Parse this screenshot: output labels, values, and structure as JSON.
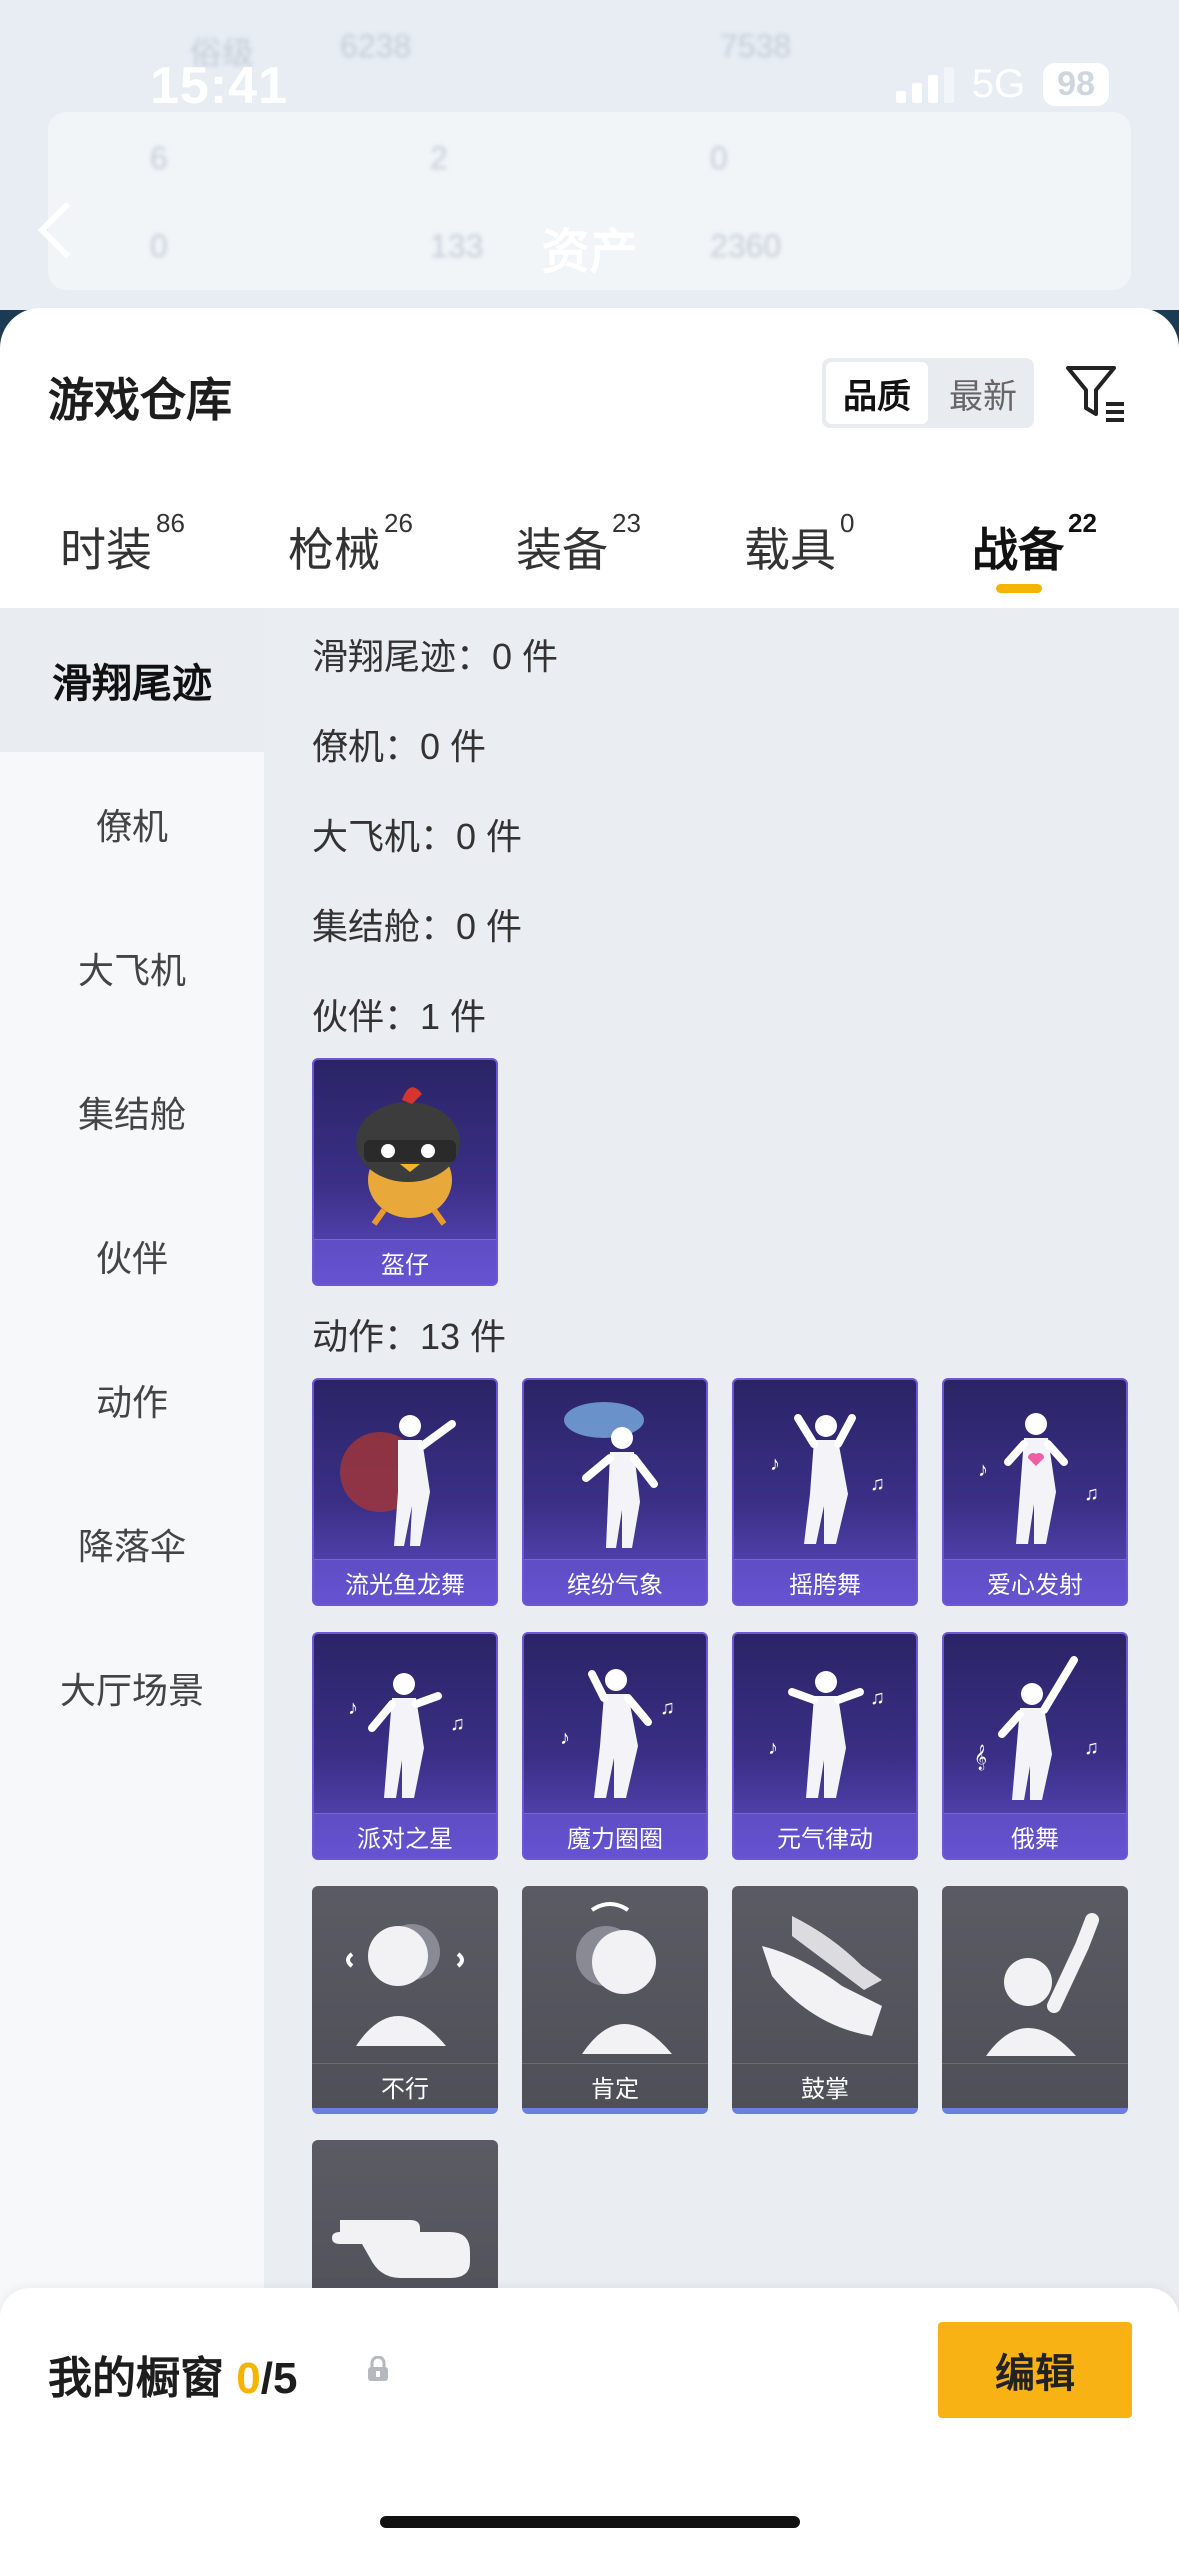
{
  "status_bar": {
    "time": "15:41",
    "network": "5G",
    "battery": "98"
  },
  "background": {
    "title": "资产",
    "ghost_texts": [
      "俗级",
      "6238",
      "7538",
      "6",
      "2",
      "0",
      "0",
      "133",
      "2360"
    ]
  },
  "sheet": {
    "title": "游戏仓库",
    "sort": {
      "quality": "品质",
      "latest": "最新"
    },
    "tabs": [
      {
        "label": "时装",
        "count": "86"
      },
      {
        "label": "枪械",
        "count": "26"
      },
      {
        "label": "装备",
        "count": "23"
      },
      {
        "label": "载具",
        "count": "0"
      },
      {
        "label": "战备",
        "count": "22"
      }
    ],
    "sidebar": [
      {
        "label": "滑翔尾迹"
      },
      {
        "label": "僚机"
      },
      {
        "label": "大飞机"
      },
      {
        "label": "集结舱"
      },
      {
        "label": "伙伴"
      },
      {
        "label": "动作"
      },
      {
        "label": "降落伞"
      },
      {
        "label": "大厅场景"
      }
    ],
    "categories": [
      {
        "label": "滑翔尾迹：0 件"
      },
      {
        "label": "僚机：0 件"
      },
      {
        "label": "大飞机：0 件"
      },
      {
        "label": "集结舱：0 件"
      },
      {
        "label": "伙伴：1 件"
      },
      {
        "label": "动作：13 件"
      }
    ],
    "partner_items": [
      {
        "name": "盔仔"
      }
    ],
    "action_items": [
      {
        "name": "流光鱼龙舞"
      },
      {
        "name": "缤纷气象"
      },
      {
        "name": "摇胯舞"
      },
      {
        "name": "爱心发射"
      },
      {
        "name": "派对之星"
      },
      {
        "name": "魔力圈圈"
      },
      {
        "name": "元气律动"
      },
      {
        "name": "俄舞"
      },
      {
        "name": "不行"
      },
      {
        "name": "肯定"
      },
      {
        "name": "鼓掌"
      },
      {
        "name": ""
      },
      {
        "name": ""
      }
    ]
  },
  "footer": {
    "title": "我的橱窗 ",
    "count": "0",
    "total": "/5",
    "edit": "编辑"
  },
  "colors": {
    "accent": "#f5b400",
    "card_purple": "#3a2f86",
    "card_gray": "#55555e",
    "fab": "#f6b314"
  }
}
